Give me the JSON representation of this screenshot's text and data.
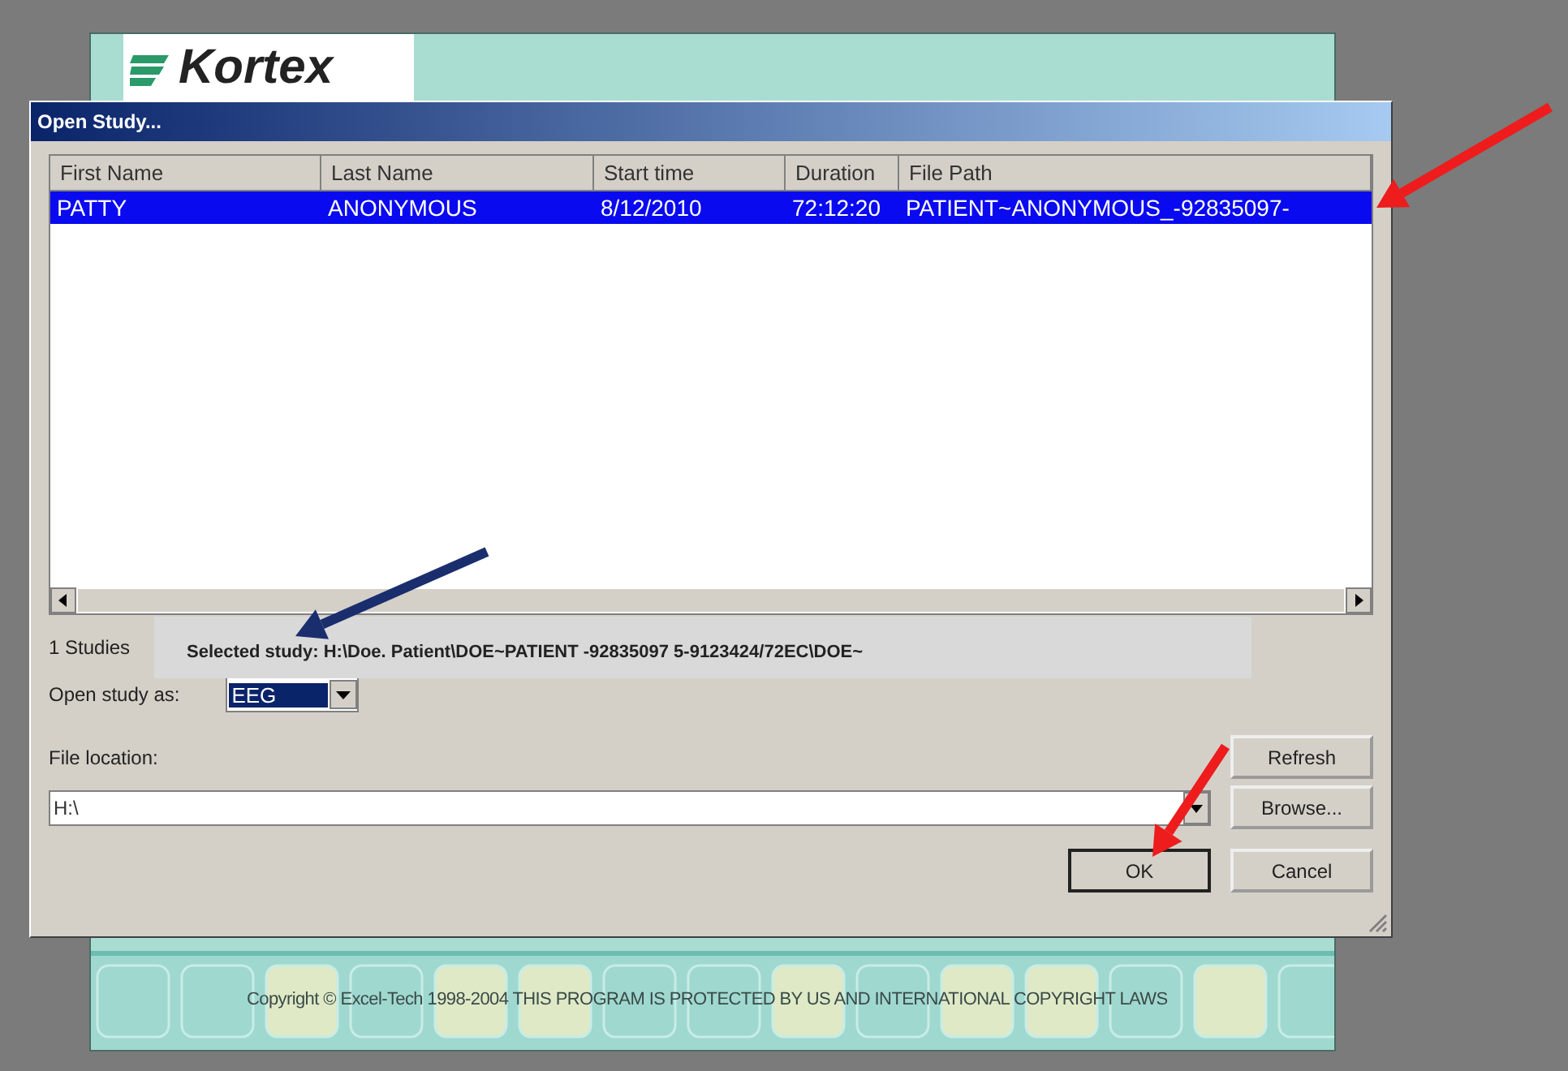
{
  "background_window": {
    "logo": "Kortex",
    "footer": "Copyright © Excel-Tech 1998-2004 THIS PROGRAM IS PROTECTED BY US AND INTERNATIONAL COPYRIGHT LAWS"
  },
  "dialog": {
    "title": "Open Study...",
    "table": {
      "columns": [
        "First Name",
        "Last Name",
        "Start time",
        "Duration",
        "File Path"
      ],
      "rows": [
        {
          "cells": [
            "PATTY",
            "ANONYMOUS",
            "8/12/2010",
            "72:12:20",
            "PATIENT~ANONYMOUS_-92835097-"
          ],
          "selected": true
        }
      ]
    },
    "study_count": "1 Studies",
    "tooltip": "Selected study: H:\\Doe. Patient\\DOE~PATIENT -92835097 5-9123424/72EC\\DOE~",
    "open_as": {
      "label": "Open study as:",
      "value": "EEG"
    },
    "file_location": {
      "label": "File location:",
      "value": "H:\\"
    },
    "buttons": [
      {
        "label": "Refresh",
        "default": false
      },
      {
        "label": "Browse...",
        "default": false
      },
      {
        "label": "OK",
        "default": true
      },
      {
        "label": "Cancel",
        "default": false
      }
    ]
  },
  "annotations": [
    {
      "color": "#ee1c1c"
    },
    {
      "color": "#1a2e6e"
    },
    {
      "color": "#ee1c1c"
    }
  ]
}
